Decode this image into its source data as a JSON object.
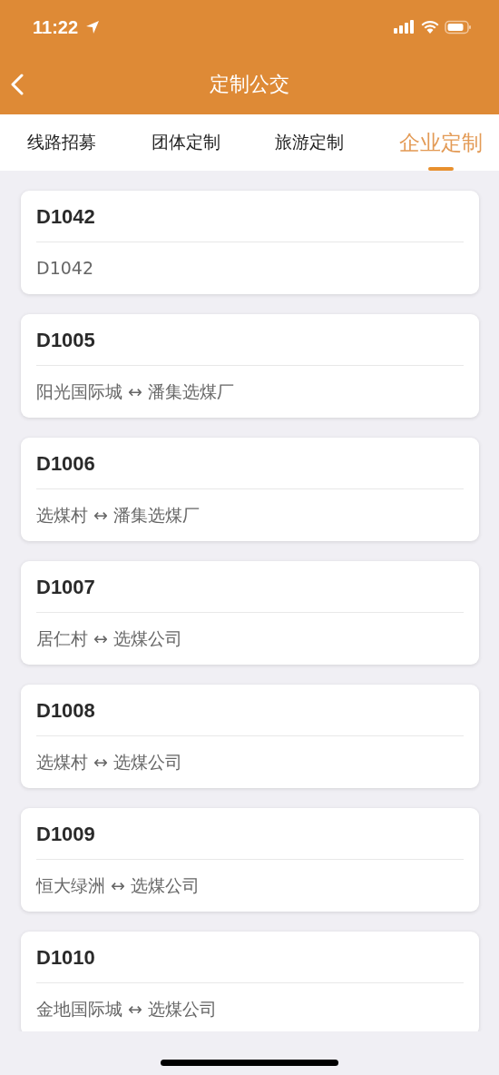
{
  "status_bar": {
    "time": "11:22"
  },
  "nav": {
    "title": "定制公交"
  },
  "tabs": [
    {
      "label": "线路招募",
      "selected": false
    },
    {
      "label": "团体定制",
      "selected": false
    },
    {
      "label": "旅游定制",
      "selected": false
    },
    {
      "label": "企业定制",
      "selected": true
    }
  ],
  "routes": [
    {
      "code": "D1042",
      "description": "D1042"
    },
    {
      "code": "D1005",
      "description": "阳光国际城 ↔ 潘集选煤厂"
    },
    {
      "code": "D1006",
      "description": "选煤村 ↔ 潘集选煤厂"
    },
    {
      "code": "D1007",
      "description": "居仁村 ↔ 选煤公司"
    },
    {
      "code": "D1008",
      "description": "选煤村 ↔ 选煤公司"
    },
    {
      "code": "D1009",
      "description": "恒大绿洲 ↔ 选煤公司"
    },
    {
      "code": "D1010",
      "description": "金地国际城 ↔ 选煤公司"
    }
  ]
}
